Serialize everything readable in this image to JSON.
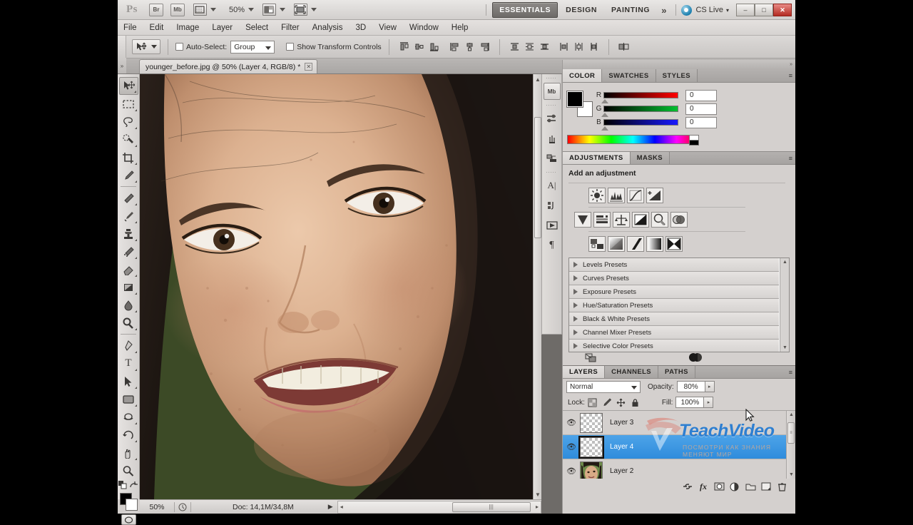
{
  "app": {
    "name": "Adobe Photoshop CS5",
    "logo_text": "Ps"
  },
  "titlebar": {
    "bridge_label": "Br",
    "minibridge_label": "Mb",
    "zoom_value": "50%",
    "workspaces": [
      {
        "label": "ESSENTIALS",
        "active": true
      },
      {
        "label": "DESIGN",
        "active": false
      },
      {
        "label": "PAINTING",
        "active": false
      }
    ],
    "more_workspaces": "»",
    "cs_live_label": "CS Live",
    "cs_live_caret": "▾",
    "window_buttons": [
      {
        "name": "minimize",
        "glyph": "–"
      },
      {
        "name": "maximize",
        "glyph": "□"
      },
      {
        "name": "close",
        "glyph": "✕"
      }
    ]
  },
  "menubar": {
    "items": [
      "File",
      "Edit",
      "Image",
      "Layer",
      "Select",
      "Filter",
      "Analysis",
      "3D",
      "View",
      "Window",
      "Help"
    ]
  },
  "optionsbar": {
    "tool_icon": "move-tool",
    "auto_select_label": "Auto-Select:",
    "auto_select_checked": false,
    "auto_select_value": "Group",
    "show_transform_label": "Show Transform Controls",
    "show_transform_checked": false,
    "align_group_1": [
      "align-top-edges",
      "align-vertical-centers",
      "align-bottom-edges"
    ],
    "align_group_2": [
      "align-left-edges",
      "align-horizontal-centers",
      "align-right-edges"
    ],
    "distribute_group_1": [
      "distribute-top-edges",
      "distribute-vertical-centers",
      "distribute-bottom-edges"
    ],
    "distribute_group_2": [
      "distribute-left-edges",
      "distribute-horizontal-centers",
      "distribute-right-edges"
    ],
    "auto_align_label": "auto-align-layers"
  },
  "document": {
    "tab_title": "younger_before.jpg @ 50% (Layer 4, RGB/8) *",
    "close_glyph": "✕"
  },
  "tools": [
    {
      "name": "move-tool",
      "glyph": "✥",
      "selected": true
    },
    {
      "name": "rectangular-marquee-tool",
      "glyph": "⬚",
      "selected": false
    },
    {
      "name": "lasso-tool",
      "glyph": "❀",
      "selected": false
    },
    {
      "name": "quick-selection-tool",
      "glyph": "❂",
      "selected": false
    },
    {
      "name": "crop-tool",
      "glyph": "⌘",
      "selected": false
    },
    {
      "name": "eyedropper-tool",
      "glyph": "✐",
      "selected": false
    },
    {
      "name": "spot-healing-brush-tool",
      "glyph": "✎",
      "selected": false
    },
    {
      "name": "brush-tool",
      "glyph": "✒",
      "selected": false
    },
    {
      "name": "clone-stamp-tool",
      "glyph": "⚑",
      "selected": false
    },
    {
      "name": "history-brush-tool",
      "glyph": "✐",
      "selected": false
    },
    {
      "name": "eraser-tool",
      "glyph": "▭",
      "selected": false
    },
    {
      "name": "gradient-tool",
      "glyph": "◧",
      "selected": false
    },
    {
      "name": "blur-tool",
      "glyph": "●",
      "selected": false
    },
    {
      "name": "dodge-tool",
      "glyph": "⚲",
      "selected": false
    },
    {
      "name": "pen-tool",
      "glyph": "✒",
      "selected": false
    },
    {
      "name": "horizontal-type-tool",
      "glyph": "T",
      "selected": false
    },
    {
      "name": "path-selection-tool",
      "glyph": "➤",
      "selected": false
    },
    {
      "name": "rectangle-tool",
      "glyph": "■",
      "selected": false
    },
    {
      "name": "3d-object-rotate-tool",
      "glyph": "⛁",
      "selected": false
    },
    {
      "name": "3d-camera-rotate-tool",
      "glyph": "↺",
      "selected": false
    },
    {
      "name": "hand-tool",
      "glyph": "✋",
      "selected": false
    },
    {
      "name": "zoom-tool",
      "glyph": "⚲",
      "selected": false
    }
  ],
  "color_swatches": {
    "foreground": "#000000",
    "background": "#ffffff"
  },
  "statusbar": {
    "zoom": "50%",
    "doc_info": "Doc: 14,1M/34,8M",
    "arrow_glyph": "▶",
    "left_arrow": "◂",
    "right_arrow": "▸",
    "thumb_grip": "|||"
  },
  "icon_dock": {
    "items": [
      {
        "name": "mini-bridge-icon",
        "label": "Mb"
      },
      {
        "name": "adjustments-dock-icon",
        "glyph": "⚒"
      },
      {
        "name": "brush-presets-dock-icon",
        "glyph": "☂"
      },
      {
        "name": "clone-source-dock-icon",
        "glyph": "⚑"
      },
      {
        "name": "character-panel-icon",
        "glyph": "A"
      },
      {
        "name": "paragraph-panel-icon",
        "glyph": "¶"
      },
      {
        "name": "animation-panel-icon",
        "glyph": "▶"
      },
      {
        "name": "paragraph-marks-icon",
        "glyph": "¶"
      }
    ]
  },
  "color_panel": {
    "tabs": [
      {
        "label": "COLOR",
        "active": true
      },
      {
        "label": "SWATCHES",
        "active": false
      },
      {
        "label": "STYLES",
        "active": false
      }
    ],
    "menu_glyph": "≡",
    "channels": [
      {
        "label": "R",
        "value": "0"
      },
      {
        "label": "G",
        "value": "0"
      },
      {
        "label": "B",
        "value": "0"
      }
    ]
  },
  "adjustments_panel": {
    "tabs": [
      {
        "label": "ADJUSTMENTS",
        "active": true
      },
      {
        "label": "MASKS",
        "active": false
      }
    ],
    "menu_glyph": "≡",
    "heading": "Add an adjustment",
    "row1": [
      "brightness-contrast-icon",
      "levels-icon",
      "curves-icon",
      "exposure-icon"
    ],
    "row2": [
      "vibrance-icon",
      "hue-saturation-icon",
      "color-balance-icon",
      "black-white-icon",
      "photo-filter-icon",
      "channel-mixer-icon"
    ],
    "row3": [
      "invert-icon",
      "posterize-icon",
      "threshold-icon",
      "gradient-map-icon",
      "selective-color-icon"
    ],
    "presets": [
      "Levels Presets",
      "Curves Presets",
      "Exposure Presets",
      "Hue/Saturation Presets",
      "Black & White Presets",
      "Channel Mixer Presets",
      "Selective Color Presets"
    ],
    "footer_icons": [
      "clip-to-layer-icon",
      "preview-toggle-icon"
    ]
  },
  "layers_panel": {
    "tabs": [
      {
        "label": "LAYERS",
        "active": true
      },
      {
        "label": "CHANNELS",
        "active": false
      },
      {
        "label": "PATHS",
        "active": false
      }
    ],
    "menu_glyph": "≡",
    "blend_mode": "Normal",
    "opacity_label": "Opacity:",
    "opacity_value": "80%",
    "lock_label": "Lock:",
    "lock_icons": [
      "lock-transparent-pixels-icon",
      "lock-image-pixels-icon",
      "lock-position-icon",
      "lock-all-icon"
    ],
    "fill_label": "Fill:",
    "fill_value": "100%",
    "layers": [
      {
        "name": "Layer 3",
        "selected": false,
        "thumb": "transparent",
        "visible": true
      },
      {
        "name": "Layer 4",
        "selected": true,
        "thumb": "transparent",
        "visible": true
      },
      {
        "name": "Layer 2",
        "selected": false,
        "thumb": "photo",
        "visible": true
      }
    ],
    "footer_icons": [
      "link-layers-icon",
      "layer-style-icon",
      "layer-mask-icon",
      "new-adjustment-layer-icon",
      "new-group-icon",
      "new-layer-icon",
      "delete-layer-icon"
    ]
  },
  "watermark": {
    "text": "TeachVideo",
    "subtext": "ПОСМОТРИ КАК ЗНАНИЯ МЕНЯЮТ МИР"
  },
  "colors": {
    "accent_blue": "#2f8cdc",
    "panel_bg": "#d4d0ce",
    "canvas_bg": "#6e6b68",
    "close_red": "#b32b22"
  }
}
